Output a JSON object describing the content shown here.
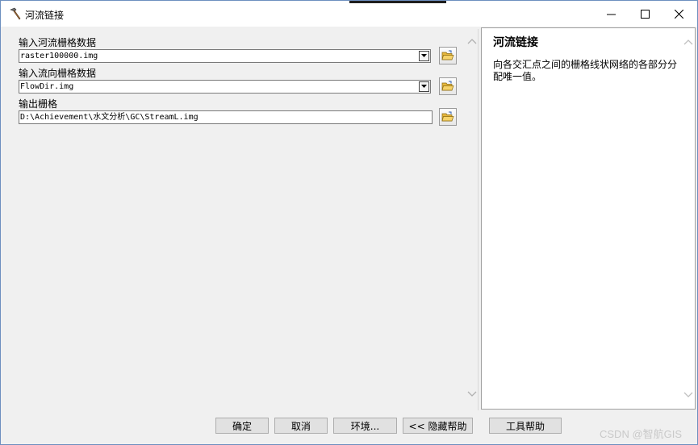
{
  "window": {
    "title": "河流链接",
    "icon": "hammer-icon"
  },
  "form": {
    "stream_raster_label": "输入河流栅格数据",
    "stream_raster_value": "raster100000.img",
    "flowdir_raster_label": "输入流向栅格数据",
    "flowdir_raster_value": "FlowDir.img",
    "output_raster_label": "输出栅格",
    "output_raster_value": "D:\\Achievement\\水文分析\\GC\\StreamL.img"
  },
  "help": {
    "title": "河流链接",
    "body": "向各交汇点之间的栅格线状网络的各部分分配唯一值。"
  },
  "buttons": {
    "ok": "确定",
    "cancel": "取消",
    "environments": "环境...",
    "hide_help": "<< 隐藏帮助",
    "tool_help": "工具帮助"
  },
  "watermark": "CSDN @智航GIS",
  "colors": {
    "window_border": "#6d8fbf",
    "folder_yellow": "#f2c14e"
  }
}
